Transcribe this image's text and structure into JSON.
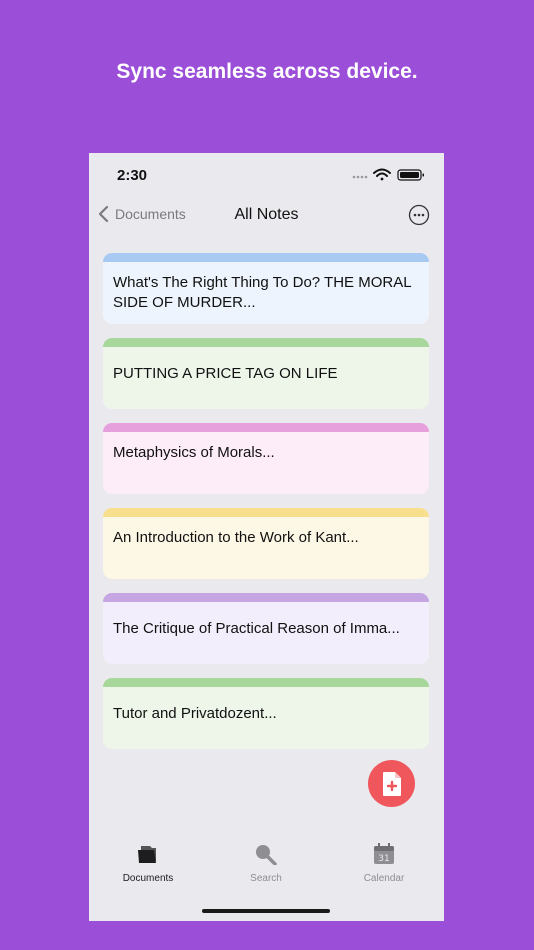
{
  "headline": "Sync seamless across device.",
  "status_bar": {
    "time": "2:30"
  },
  "nav": {
    "back_label": "Documents",
    "title": "All Notes"
  },
  "notes": [
    {
      "title": "What's The Right Thing To Do? THE MORAL SIDE OF MURDER...",
      "stripe_color": "#a8c9f2",
      "bg_color": "#edf4fd"
    },
    {
      "title": "PUTTING A PRICE TAG ON LIFE",
      "stripe_color": "#a8d79b",
      "bg_color": "#eef6ea"
    },
    {
      "title": "Metaphysics of Morals...",
      "stripe_color": "#e6a0dc",
      "bg_color": "#fcedf9"
    },
    {
      "title": "An Introduction to the Work of Kant...",
      "stripe_color": "#f8df8e",
      "bg_color": "#fdf7e5"
    },
    {
      "title": "The Critique of Practical Reason of Imma...",
      "stripe_color": "#c6a6e2",
      "bg_color": "#f3eefb"
    },
    {
      "title": "Tutor and Privatdozent...",
      "stripe_color": "#a8d79b",
      "bg_color": "#eef6ea"
    }
  ],
  "tabs": [
    {
      "label": "Documents",
      "icon": "documents-icon",
      "active": true
    },
    {
      "label": "Search",
      "icon": "search-icon",
      "active": false
    },
    {
      "label": "Calendar",
      "icon": "calendar-icon",
      "active": false
    }
  ],
  "calendar_icon_day": "31",
  "colors": {
    "background": "#9b4fd8",
    "fab": "#f0575c",
    "active_tab": "#1d1d1f",
    "inactive_tab": "#8e8e93"
  }
}
